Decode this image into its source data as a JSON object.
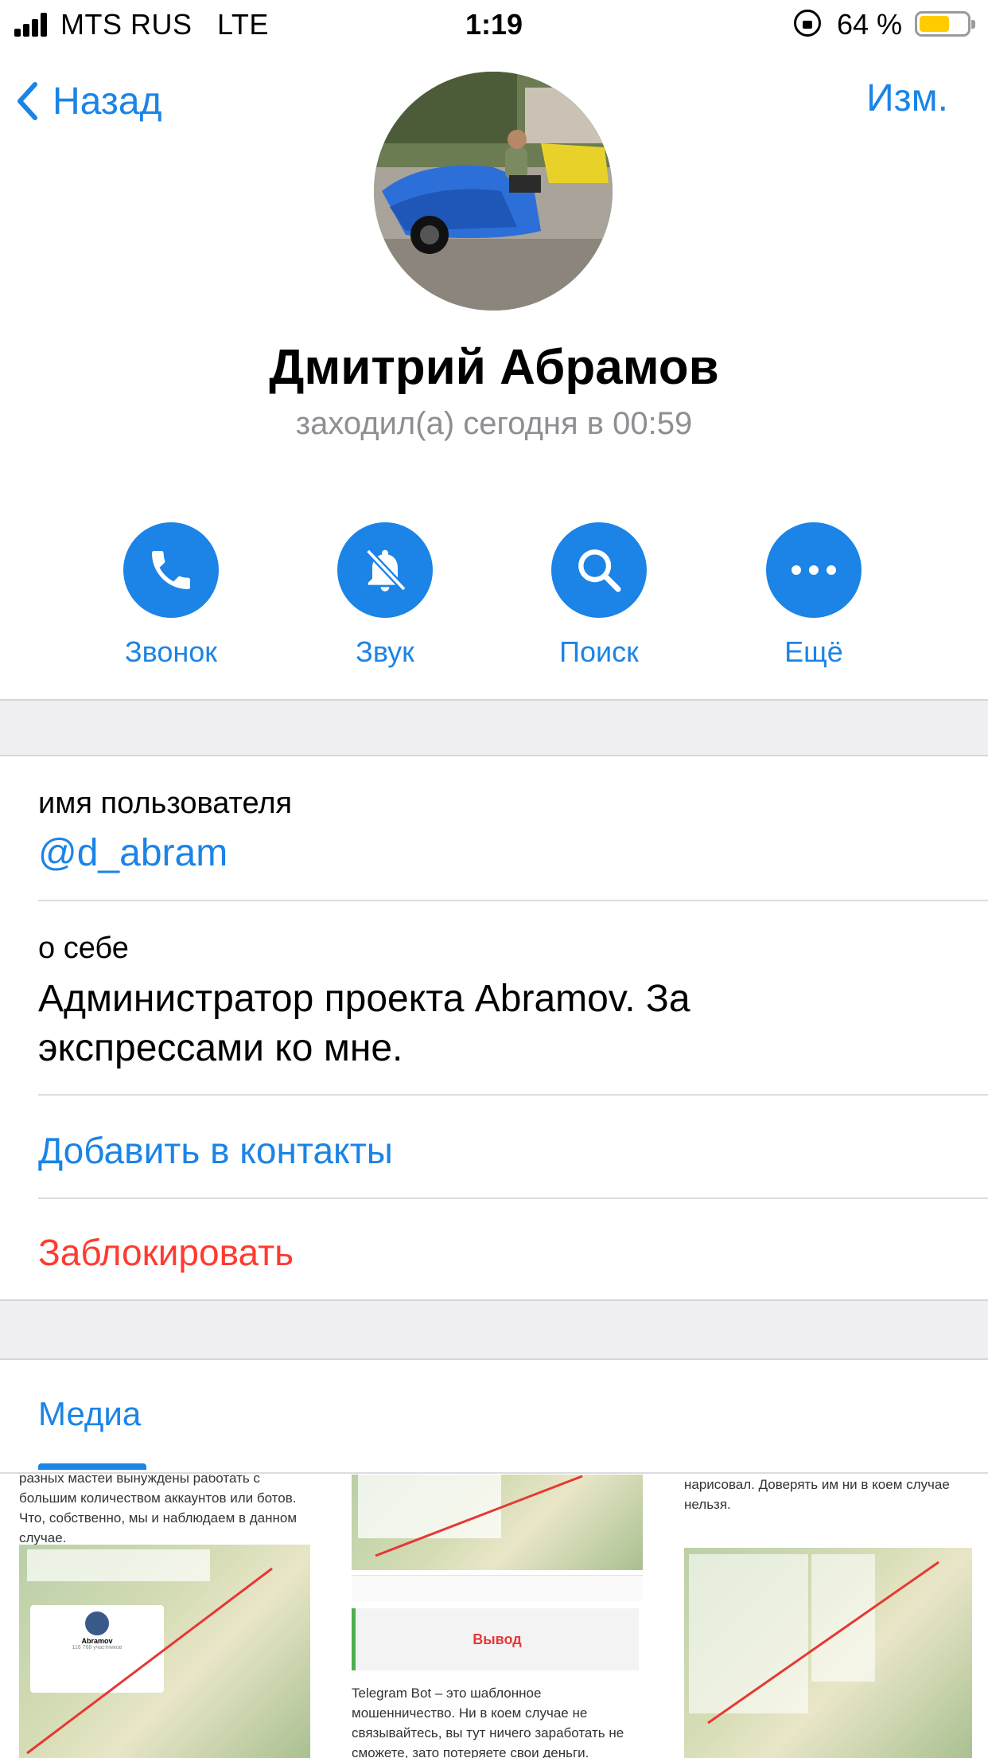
{
  "status_bar": {
    "carrier": "MTS RUS",
    "network": "LTE",
    "time": "1:19",
    "battery_percent": "64 %",
    "battery_level": 0.64,
    "icons": [
      "signal-icon",
      "orientation-lock-icon",
      "battery-icon"
    ]
  },
  "nav": {
    "back_label": "Назад",
    "edit_label": "Изм."
  },
  "profile": {
    "name": "Дмитрий Абрамов",
    "last_seen": "заходил(а) сегодня в 00:59"
  },
  "actions": [
    {
      "label": "Звонок",
      "icon": "phone-icon"
    },
    {
      "label": "Звук",
      "icon": "bell-muted-icon"
    },
    {
      "label": "Поиск",
      "icon": "search-icon"
    },
    {
      "label": "Ещё",
      "icon": "more-dots-icon"
    }
  ],
  "info": {
    "username_label": "имя пользователя",
    "username_value": "@d_abram",
    "about_label": "о себе",
    "about_value": "Администратор проекта Abramov. За экспрессами ко мне.",
    "add_contact": "Добавить в контакты",
    "block": "Заблокировать"
  },
  "media": {
    "tab_label": "Медиа",
    "thumbs": [
      {
        "text": "разных мастей вынуждены работать с большим количеством аккаунтов или ботов. Что, собственно, мы и наблюдаем в данном случае.",
        "inner_title": "Abramov",
        "inner_sub": "116 768 участников"
      },
      {
        "callout": "Вывод",
        "text": "Telegram Bot – это шаблонное мошенничество. Ни в коем случае не связывайтесь, вы тут ничего заработать не сможете, зато потеряете свои деньги."
      },
      {
        "text": "нарисовал. Доверять им ни в коем случае нельзя."
      }
    ]
  },
  "colors": {
    "accent": "#1b84e6",
    "destructive": "#ff3b30",
    "separator_bg": "#efeff4",
    "secondary_text": "#8e8e93",
    "battery": "#ffcc00"
  }
}
